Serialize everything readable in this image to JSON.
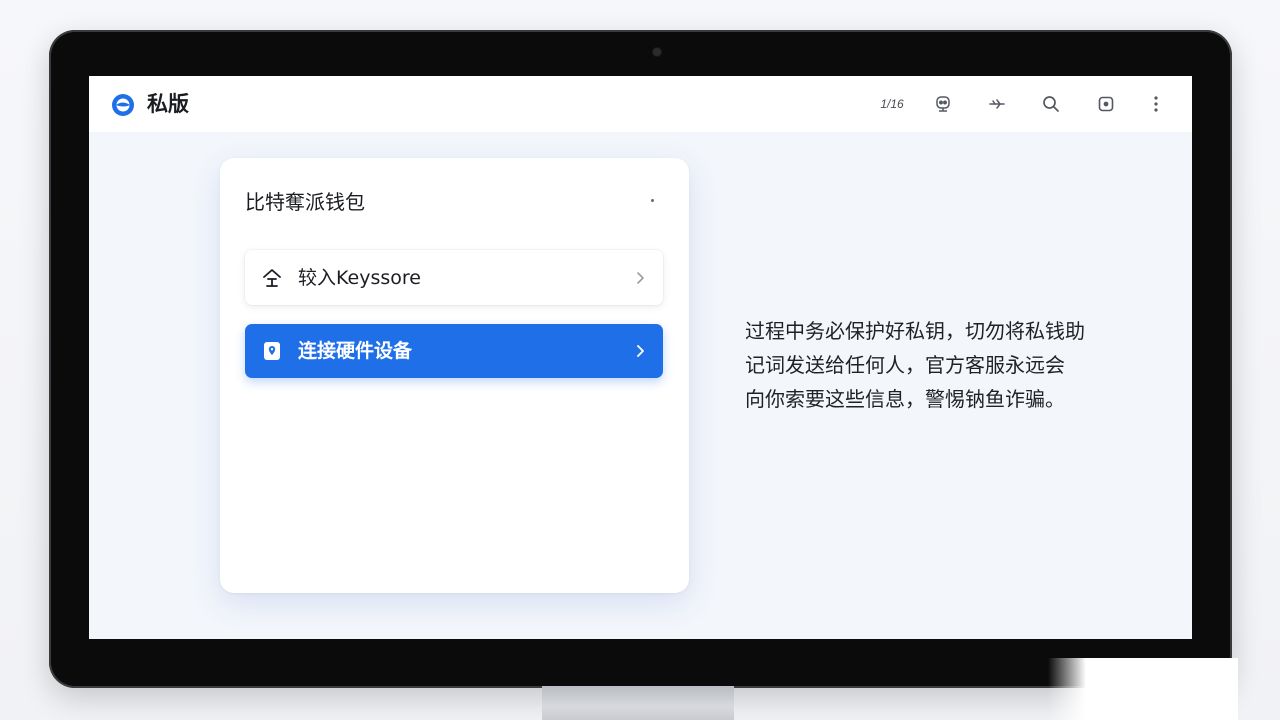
{
  "topbar": {
    "app_name": "私版",
    "page_indicator": "1/16",
    "icons": [
      "robot-icon",
      "airplane-icon",
      "search-icon",
      "screen-icon",
      "more-icon"
    ]
  },
  "card": {
    "title": "比特奪派钱包",
    "options": [
      {
        "label": "较入Keyssore",
        "icon": "import-icon",
        "selected": false
      },
      {
        "label": "连接硬件设备",
        "icon": "device-icon",
        "selected": true
      }
    ]
  },
  "warning": {
    "lines": [
      "过程中务必保护好私钥，切勿将私钱助",
      "记词发送给任何人，官方客服永远会",
      "向你索要这些信息，警惕钠鱼诈骗。"
    ]
  },
  "colors": {
    "accent": "#1f6fe8",
    "screen_bg": "#f3f6fb",
    "bezel": "#0b0b0c"
  }
}
